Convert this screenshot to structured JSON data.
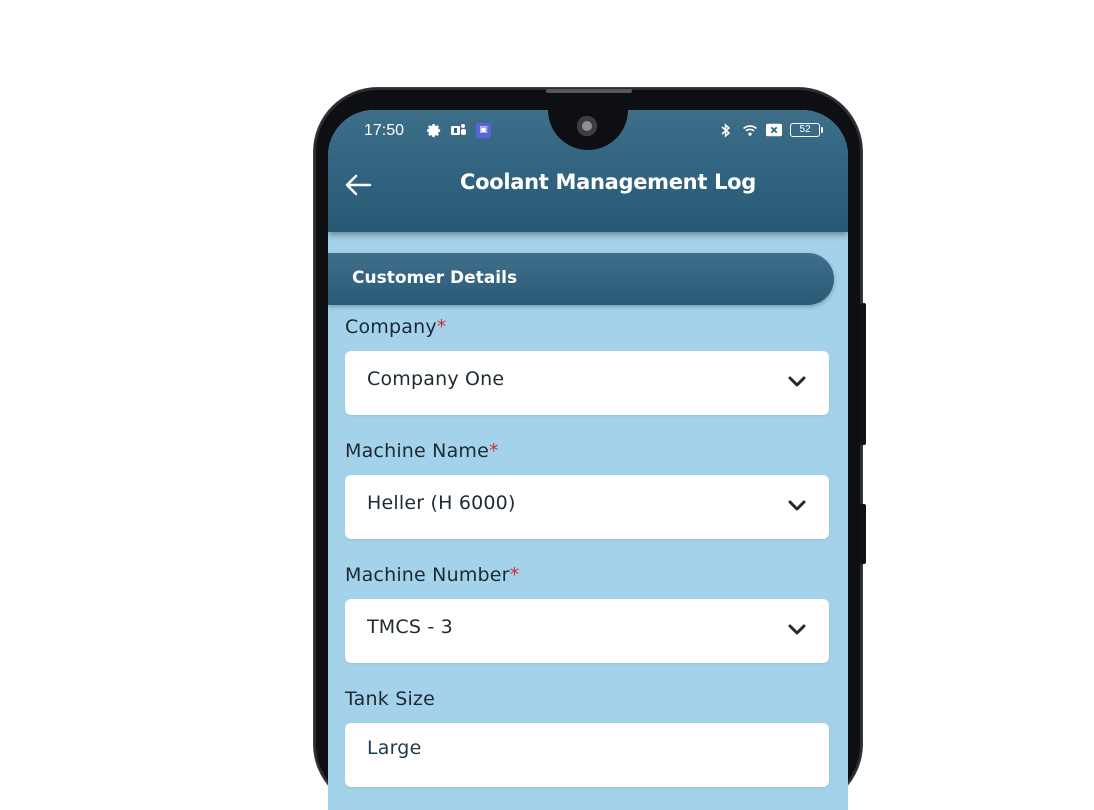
{
  "status_bar": {
    "time": "17:50",
    "left_icons": [
      "gear-icon",
      "teams-icon",
      "app-badge-icon"
    ],
    "right_icons": [
      "bluetooth-icon",
      "wifi-icon",
      "sim-off-icon",
      "battery-icon"
    ],
    "battery_level": "52"
  },
  "app_bar": {
    "title": "Coolant Management Log",
    "back_icon": "back-arrow-icon"
  },
  "section": {
    "title": "Customer Details"
  },
  "form": {
    "company": {
      "label": "Company",
      "required_mark": "*",
      "value": "Company One"
    },
    "machine_name": {
      "label": "Machine Name",
      "required_mark": "*",
      "value": "Heller (H 6000)"
    },
    "machine_number": {
      "label": "Machine Number",
      "required_mark": "*",
      "value": "TMCS - 3"
    },
    "tank_size": {
      "label": "Tank Size",
      "value": "Large"
    }
  },
  "colors": {
    "app_bar": "#2f627e",
    "background": "#a3d2ea",
    "required": "#d32f2f"
  }
}
